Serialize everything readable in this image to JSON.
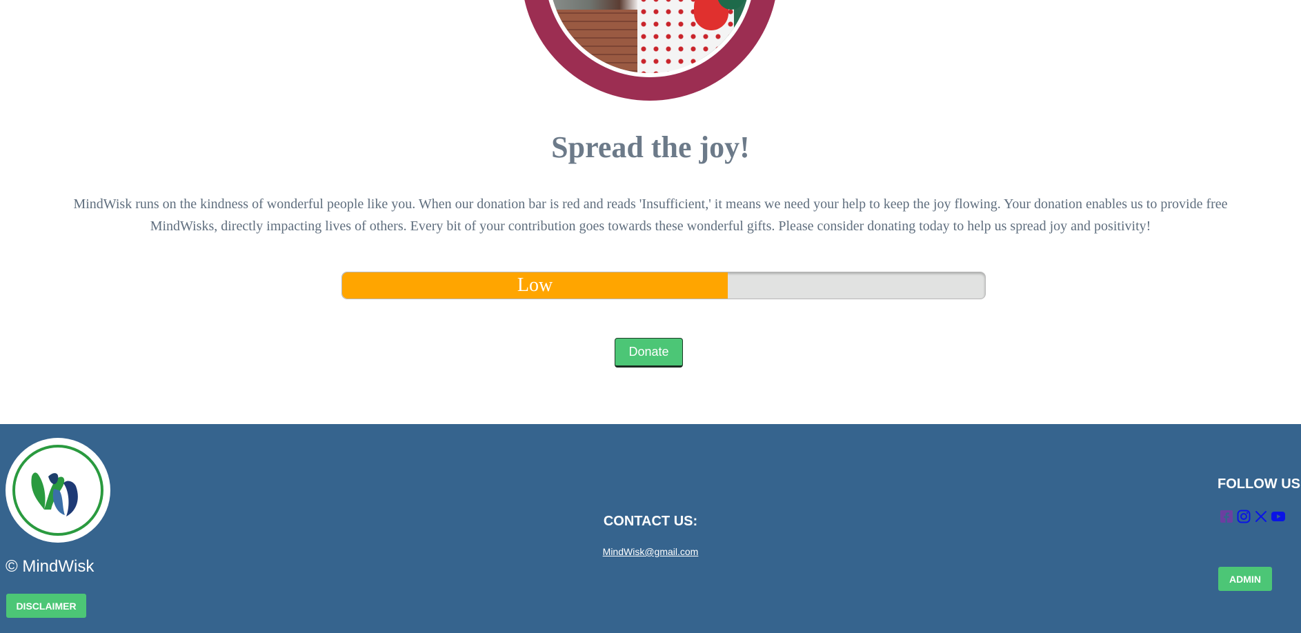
{
  "main": {
    "heading": "Spread the joy!",
    "intro": "MindWisk runs on the kindness of wonderful people like you. When our donation bar is red and reads 'Insufficient,' it means we need your help to keep the joy flowing. Your donation enables us to provide free MindWisks, directly impacting lives of others. Every bit of your contribution goes towards these wonderful gifts. Please consider donating today to help us spread joy and positivity!",
    "donation_bar": {
      "label": "Low",
      "level": 0.6,
      "fill_color": "#ffa500",
      "track_color": "#e1e2e1"
    },
    "donate_label": "Donate"
  },
  "footer": {
    "background": "#36648e",
    "copyright": "© MindWisk",
    "disclaimer_label": "DISCLAIMER",
    "contact_title": "CONTACT US:",
    "contact_email": "MindWisk@gmail.com",
    "follow_title": "FOLLOW US",
    "social_icons": [
      "facebook-icon",
      "instagram-icon",
      "x-icon",
      "youtube-icon"
    ],
    "admin_label": "ADMIN"
  },
  "colors": {
    "accent_green": "#4cc676",
    "hero_ring": "#9c2e52",
    "heading_text": "#6c7a89"
  }
}
